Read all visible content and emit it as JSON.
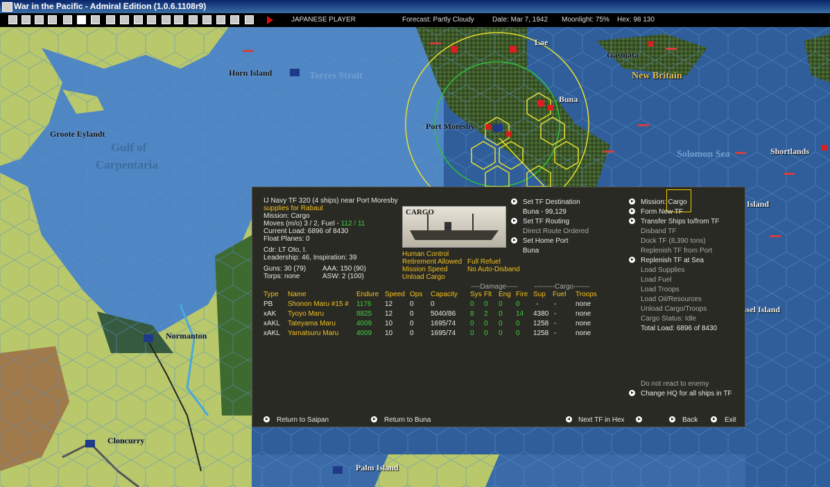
{
  "window": {
    "title": "War in the Pacific - Admiral Edition (1.0.6.1108r9)"
  },
  "status": {
    "player": "JAPANESE PLAYER",
    "forecast": "Forecast: Partly Cloudy",
    "date": "Date: Mar 7, 1942",
    "moonlight": "Moonlight: 75%",
    "hex": "Hex: 98 130"
  },
  "map": {
    "places": {
      "lae": "Lae",
      "gasmata": "Gasmata",
      "new_britain": "New Britain",
      "horn_island": "Horn Island",
      "torres_strait": "Torres Strait",
      "buna": "Buna",
      "port_moresby": "Port Moresby",
      "groote_eylandt": "Groote Eylandt",
      "gulf_of": "Gulf of",
      "carpentaria": "Carpentaria",
      "solomon_sea": "Solomon Sea",
      "shortlands": "Shortlands",
      "island_partial": "Island",
      "ssel_island": "ssel Island",
      "normanton": "Normanton",
      "cloncurry": "Cloncurry",
      "palm_island": "Palm Island"
    }
  },
  "tf": {
    "header": "IJ Navy TF 320 (4 ships)  near Port Moresby",
    "subtitle": "supplies for Rabaul",
    "mission": "Mission: Cargo",
    "moves_prefix": "Moves (m/o)  3 / 2, Fuel - ",
    "moves_fuel": "112 / 11",
    "current_load": "Current Load: 6896 of 8430",
    "float_planes": "Float Planes: 0",
    "cdr": "Cdr: LT Oto, I.",
    "leadership": "Leadership: 46, Inspiration: 39",
    "guns": "Guns: 30 (79)",
    "aaa": "AAA: 150 (90)",
    "torps": "Torps: none",
    "asw": "ASW: 2 (100)",
    "image_label": "CARGO",
    "flags": {
      "human_control": "Human Control",
      "retirement": "Retirement Allowed",
      "full_refuel": "Full Refuel",
      "mission_speed": "Mission Speed",
      "no_auto_disband": "No Auto-Disband",
      "unload_cargo": "Unload Cargo"
    }
  },
  "table": {
    "group_damage": "----Damage-----",
    "group_cargo": "---------Cargo-------",
    "columns": [
      "Type",
      "Name",
      "Endure",
      "Speed",
      "Ops",
      "Capacity",
      "Sys",
      "Flt",
      "Eng",
      "Fire",
      "Sup",
      "Fuel",
      "Troops"
    ],
    "rows": [
      {
        "type": "PB",
        "name": "Shonon Maru #15 #",
        "endure": "1176",
        "speed": "12",
        "ops": "0",
        "capacity": "0",
        "sys": "0",
        "flt": "0",
        "eng": "0",
        "fire": "0",
        "sup": "-",
        "fuel": "-",
        "troops": "none"
      },
      {
        "type": "xAK",
        "name": "Tyoyo Maru",
        "endure": "8825",
        "speed": "12",
        "ops": "0",
        "capacity": "5040/86",
        "sys": "8",
        "flt": "2",
        "eng": "0",
        "fire": "14",
        "sup": "4380",
        "fuel": "-",
        "troops": "none"
      },
      {
        "type": "xAKL",
        "name": "Tateyama Maru",
        "endure": "4009",
        "speed": "10",
        "ops": "0",
        "capacity": "1695/74",
        "sys": "0",
        "flt": "0",
        "eng": "0",
        "fire": "0",
        "sup": "1258",
        "fuel": "-",
        "troops": "none"
      },
      {
        "type": "xAKL",
        "name": "Yamatsuru Maru",
        "endure": "4009",
        "speed": "10",
        "ops": "0",
        "capacity": "1695/74",
        "sys": "0",
        "flt": "0",
        "eng": "0",
        "fire": "0",
        "sup": "1258",
        "fuel": "-",
        "troops": "none"
      }
    ]
  },
  "routing": {
    "set_destination": "Set TF Destination",
    "destination_value": "Buna - 99,129",
    "set_routing": "Set TF Routing",
    "routing_value": "Direct Route Ordered",
    "set_home_port": "Set Home Port",
    "home_port_value": "Buna"
  },
  "orders": {
    "mission_label": "Mission:",
    "mission_value": "Cargo",
    "form_new_tf": "Form New TF",
    "transfer_ships": "Transfer Ships to/from TF",
    "disband_tf": "Disband TF",
    "dock_tf": "Dock TF (8,390 tons)",
    "replenish_port": "Replenish TF from Port",
    "replenish_sea": "Replenish TF at Sea",
    "load_supplies": "Load Supplies",
    "load_fuel": "Load Fuel",
    "load_troops": "Load Troops",
    "load_oil": "Load Oil/Resources",
    "unload_cargo_troops": "Unload Cargo/Troops",
    "cargo_status": "Cargo Status: Idle",
    "total_load": "Total Load: 6896 of 8430",
    "no_react": "Do not react to enemy",
    "change_hq": "Change HQ for all ships in TF"
  },
  "footer": {
    "return_saipan": "Return to Saipan",
    "return_buna": "Return to Buna",
    "next_tf": "Next TF in Hex",
    "back": "Back",
    "exit": "Exit"
  }
}
